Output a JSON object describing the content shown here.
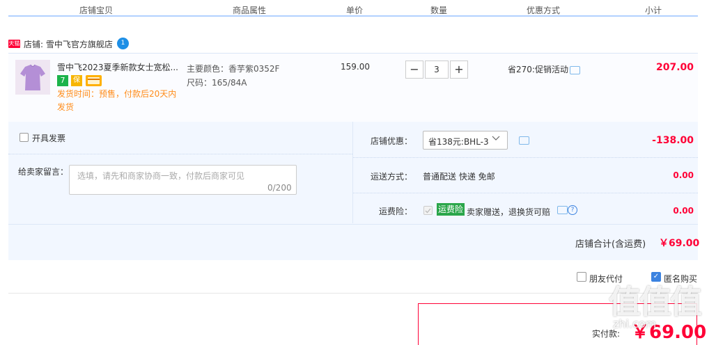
{
  "header": {
    "columns": [
      "店铺宝贝",
      "商品属性",
      "单价",
      "数量",
      "优惠方式",
      "小计"
    ]
  },
  "shop": {
    "badge": "天猫",
    "name": "店铺: 雪中飞官方旗舰店",
    "ww_badge": "1"
  },
  "item": {
    "title": "雪中飞2023夏季新款女士宽松...",
    "tag_7": "7",
    "tag_b": "保",
    "ship_time": "发货时间：预售，付款后20天内发货",
    "attr_color": "主要颜色：香芋紫0352F",
    "attr_size": "尺码：165/84A",
    "price": "159.00",
    "qty_minus": "−",
    "qty_value": "3",
    "qty_plus": "+",
    "promo": "省270:促销活动",
    "subtotal": "207.00"
  },
  "invoice": {
    "label": "开具发票"
  },
  "message": {
    "label": "给卖家留言：",
    "placeholder": "选填，请先和商家协商一致，付款后商家可见",
    "count": "0/200"
  },
  "shop_discount": {
    "label": "店铺优惠：",
    "selected": "省138元:BHL-3",
    "amount": "-138.00"
  },
  "shipping": {
    "label": "运送方式：",
    "value": "普通配送 快递 免邮",
    "amount": "0.00"
  },
  "insurance": {
    "label": "运费险：",
    "tag": "运费险",
    "desc": "卖家赠送，退换货可赔",
    "amount": "0.00"
  },
  "shop_total": {
    "label": "店铺合计(含运费)",
    "amount": "￥69.00"
  },
  "options": {
    "friend_pay": "朋友代付",
    "anonymous": "匿名购买"
  },
  "payment": {
    "label": "实付款:",
    "amount": "￥69.00"
  },
  "watermark": {
    "text": "值值值",
    "sub": "zhi.com"
  }
}
